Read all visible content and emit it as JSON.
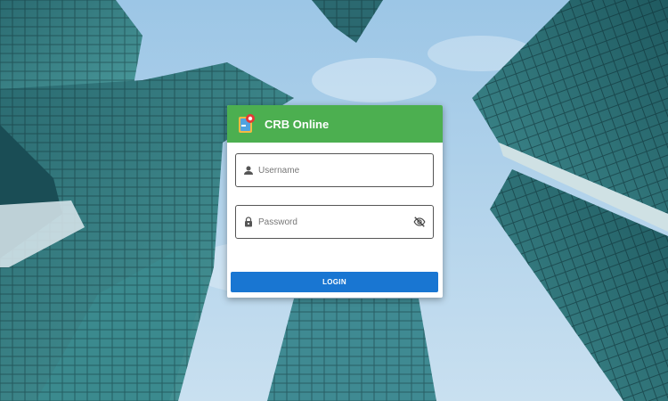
{
  "header": {
    "title": "CRB Online",
    "logo_icon": "crb-logo-icon",
    "color": "#4caf50"
  },
  "form": {
    "username": {
      "value": "",
      "placeholder": "Username",
      "icon": "person-icon"
    },
    "password": {
      "value": "",
      "placeholder": "Password",
      "icon": "lock-icon",
      "toggle_icon": "eye-off-icon"
    },
    "login_label": "LOGIN",
    "login_color": "#1976d2"
  },
  "background": {
    "description_icon": "city-skyscrapers-background",
    "sky_color": "#a8d0ec",
    "glass_color": "#2e6f74"
  }
}
